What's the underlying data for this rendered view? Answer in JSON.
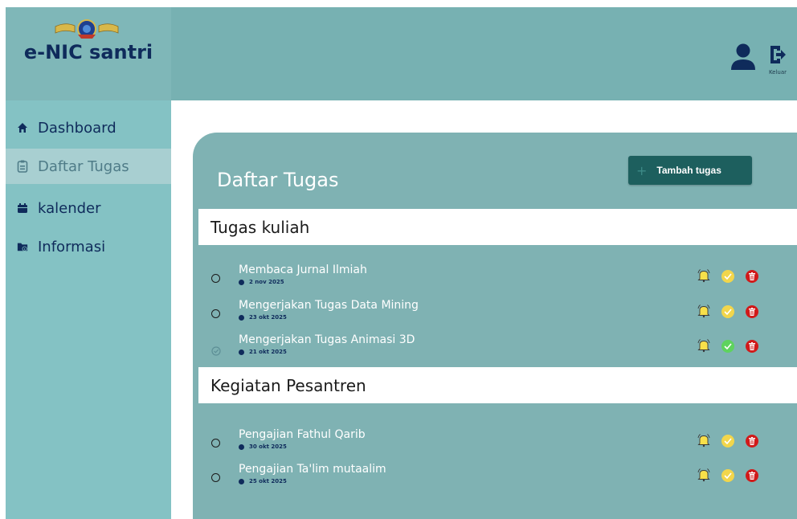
{
  "app": {
    "title": "e-NIC santri"
  },
  "sidebar": {
    "items": [
      {
        "label": "Dashboard",
        "icon": "home-icon"
      },
      {
        "label": "Daftar Tugas",
        "icon": "clipboard-icon",
        "active": true
      },
      {
        "label": "kalender",
        "icon": "calendar-icon"
      },
      {
        "label": "Informasi",
        "icon": "folder-info-icon"
      }
    ]
  },
  "header": {
    "logout_label": "Keluar"
  },
  "main": {
    "title": "Daftar Tugas",
    "add_button_label": "Tambah tugas",
    "sections": [
      {
        "title": "Tugas kuliah",
        "tasks": [
          {
            "title": "Membaca Jurnal Ilmiah",
            "date": "2 nov 2025",
            "done": false
          },
          {
            "title": "Mengerjakan Tugas Data Mining",
            "date": "23 okt 2025",
            "done": false
          },
          {
            "title": "Mengerjakan Tugas Animasi 3D",
            "date": "21 okt 2025",
            "done": true
          }
        ]
      },
      {
        "title": "Kegiatan Pesantren",
        "tasks": [
          {
            "title": "Pengajian Fathul Qarib",
            "date": "30 okt 2025",
            "done": false
          },
          {
            "title": "Pengajian Ta'lim mutaalim",
            "date": "25 okt 2025",
            "done": false
          }
        ]
      }
    ]
  },
  "colors": {
    "sidebar": "#84c2c4",
    "header": "#77b1b2",
    "panel": "#7fb2b3",
    "navy": "#0f2b5b",
    "button": "#1d5f5e",
    "pending": "#f2d64b",
    "done": "#5ed35e",
    "delete": "#d11a1a"
  }
}
